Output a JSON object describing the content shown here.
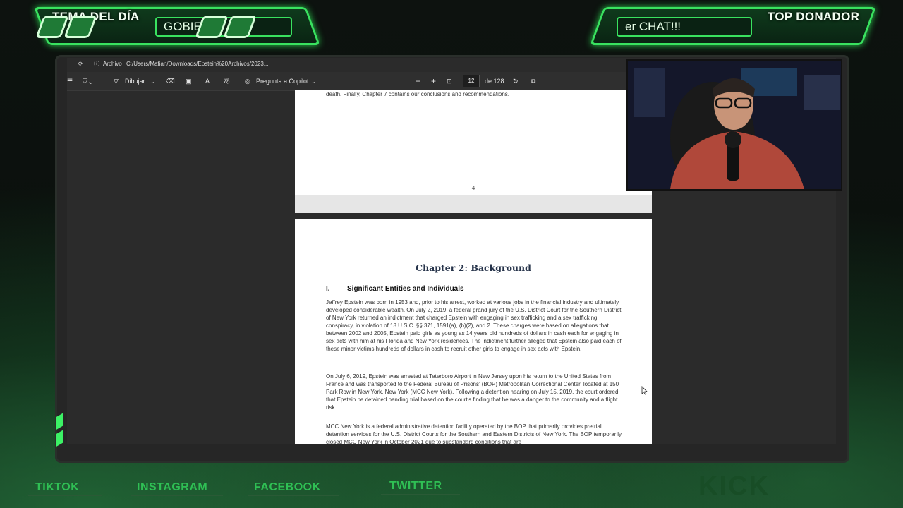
{
  "overlay": {
    "left_title": "TEMA DEL DÍA",
    "left_ticker": "GOBIEF",
    "right_title": "TOP DONADOR",
    "right_ticker": "er CHAT!!!",
    "accent_color": "#39e25f"
  },
  "browser": {
    "address_label": "Archivo",
    "address_path": "C:/Users/Mafian/Downloads/Epstein%20Archivos/2023..."
  },
  "pdf_toolbar": {
    "draw_label": "Dibujar",
    "copilot_label": "Pregunta a Copilot",
    "zoom_out": "−",
    "zoom_in": "+",
    "current_page": "12",
    "total_pages": "de 128"
  },
  "pdf": {
    "prev_page_text": "death.  Finally, Chapter 7 contains our conclusions and recommendations.",
    "prev_page_number": "4",
    "chapter_title": "Chapter 2:  Background",
    "section_number": "I.",
    "section_title": "Significant Entities and Individuals",
    "paragraph1": "Jeffrey Epstein was born in 1953 and, prior to his arrest, worked at various jobs in the financial industry and ultimately developed considerable wealth.  On July 2, 2019, a federal grand jury of the U.S. District Court for the Southern District of New York returned an indictment that charged Epstein with engaging in sex trafficking and a sex trafficking conspiracy, in violation of 18 U.S.C. §§ 371, 1591(a), (b)(2), and 2.  These charges were based on allegations that between 2002 and 2005, Epstein paid girls as young as 14 years old hundreds of dollars in cash each for engaging in sex acts with him at his Florida and New York residences.  The indictment further alleged that Epstein also paid each of these minor victims hundreds of dollars in cash to recruit other girls to engage in sex acts with Epstein.",
    "paragraph2": "On July 6, 2019, Epstein was arrested at Teterboro Airport in New Jersey upon his return to the United States from France and was transported to the Federal Bureau of Prisons' (BOP) Metropolitan Correctional Center, located at 150 Park Row in New York, New York (MCC New York).  Following a detention hearing on July 15, 2019, the court ordered that Epstein be detained pending trial based on the court's finding that he was a danger to the community and a flight risk.",
    "paragraph3": "MCC New York is a federal administrative detention facility operated by the BOP that primarily provides pretrial detention services for the U.S. District Courts for the Southern and Eastern Districts of New York.  The BOP temporarily closed MCC New York in October 2021 due to substandard conditions that are"
  },
  "social": {
    "tiktok": "TIKTOK",
    "instagram": "INSTAGRAM",
    "facebook": "FACEBOOK",
    "twitter": "TWITTER",
    "kick": "KICK"
  }
}
